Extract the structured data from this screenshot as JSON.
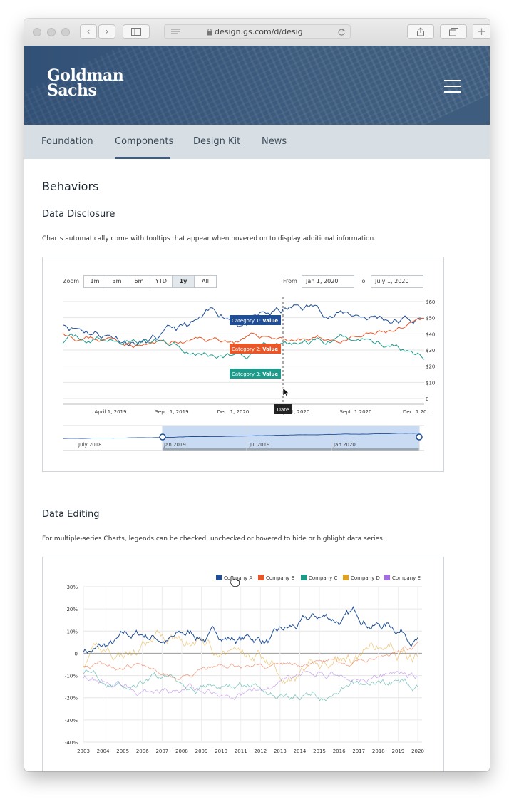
{
  "browser": {
    "url": "design.gs.com/d/desig",
    "icons": [
      "back-icon",
      "forward-icon",
      "sidebar-icon",
      "reader-icon",
      "lock-icon",
      "reload-icon",
      "share-icon",
      "tabs-icon",
      "new-tab-icon"
    ]
  },
  "brand": {
    "line1": "Goldman",
    "line2": "Sachs"
  },
  "nav": {
    "items": [
      "Foundation",
      "Components",
      "Design Kit",
      "News"
    ],
    "active": "Components"
  },
  "page": {
    "title": "Behaviors",
    "section1": {
      "heading": "Data Disclosure",
      "text": "Charts automatically come with tooltips that appear when hovered on to display additional information."
    },
    "section2": {
      "heading": "Data Editing",
      "text": "For multiple-series Charts, legends can be checked, unchecked or hovered to hide or highlight data series."
    }
  },
  "chart1_ui": {
    "zoom_label": "Zoom",
    "zoom_buttons": [
      "1m",
      "3m",
      "6m",
      "YTD",
      "1y",
      "All"
    ],
    "zoom_active": "1y",
    "from_label": "From",
    "from_value": "Jan 1, 2020",
    "to_label": "To",
    "to_value": "July 1, 2020",
    "tooltip_date": "Date",
    "tooltip_value_word": "Value"
  },
  "chart_data": [
    {
      "type": "line",
      "x_ticks": [
        "April 1, 2019",
        "Sept. 1, 2019",
        "Dec. 1, 2020",
        "Apr. 1, 2020",
        "Sept. 1 2020",
        "Dec. 1 20..."
      ],
      "y_ticks": [
        "$60",
        "$50",
        "$40",
        "$30",
        "$20",
        "$10",
        "0"
      ],
      "ylim": [
        0,
        60
      ],
      "series": [
        {
          "name": "Category 1",
          "color": "#1f4e96"
        },
        {
          "name": "Category 2",
          "color": "#e8572a"
        },
        {
          "name": "Category 3",
          "color": "#1e9a8a"
        }
      ],
      "navigator_ticks": [
        "July 2018",
        "Jan 2019",
        "Jul 2019",
        "Jan 2020"
      ],
      "grid": true
    },
    {
      "type": "line",
      "x": [
        "2003",
        "2004",
        "2005",
        "2006",
        "2007",
        "2008",
        "2009",
        "2010",
        "2011",
        "2012",
        "2013",
        "2014",
        "2015",
        "2016",
        "2017",
        "2018",
        "2019",
        "2020"
      ],
      "y_ticks": [
        "30%",
        "20%",
        "10%",
        "0",
        "-10%",
        "-20%",
        "-30%",
        "-40%"
      ],
      "ylim": [
        -40,
        30
      ],
      "series": [
        {
          "name": "Company A",
          "color": "#1f4e96"
        },
        {
          "name": "Company B",
          "color": "#e8572a"
        },
        {
          "name": "Company C",
          "color": "#1e9a8a"
        },
        {
          "name": "Company D",
          "color": "#e0a020"
        },
        {
          "name": "Company E",
          "color": "#a56de2"
        }
      ],
      "legend": "top-right",
      "grid": true
    }
  ]
}
